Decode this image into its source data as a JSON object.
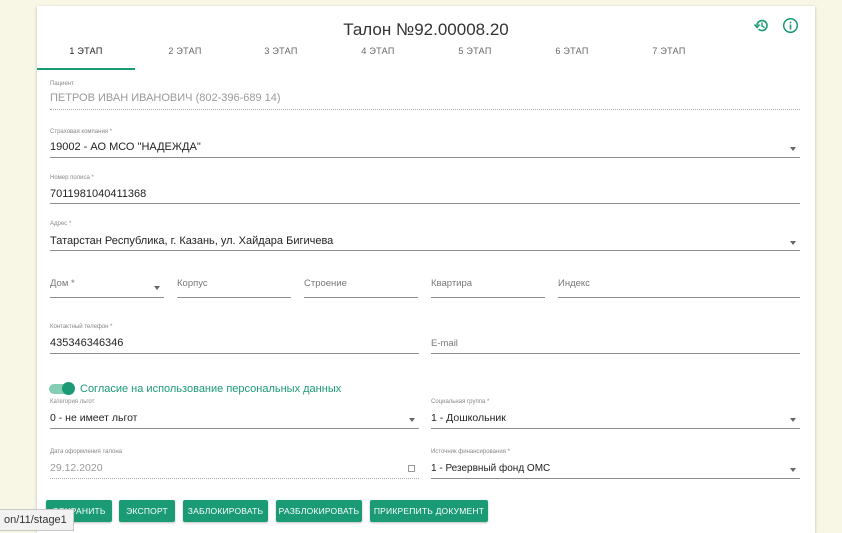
{
  "header": {
    "title": "Талон №92.00008.20",
    "history_icon": "history-icon",
    "info_icon": "info-icon",
    "accent_color": "#1a9b75"
  },
  "tabs": [
    {
      "label": "1 ЭТАП",
      "active": true
    },
    {
      "label": "2 ЭТАП",
      "active": false
    },
    {
      "label": "3 ЭТАП",
      "active": false
    },
    {
      "label": "4 ЭТАП",
      "active": false
    },
    {
      "label": "5 ЭТАП",
      "active": false
    },
    {
      "label": "6 ЭТАП",
      "active": false
    },
    {
      "label": "7 ЭТАП",
      "active": false
    }
  ],
  "form": {
    "patient": {
      "label": "Пациент",
      "value": "ПЕТРОВ ИВАН ИВАНОВИЧ (802-396-689 14)"
    },
    "insurance": {
      "label": "Страховая компания *",
      "value": "19002 - АО МСО \"НАДЕЖДА\""
    },
    "policy": {
      "label": "Номер полиса *",
      "value": "7011981040411368"
    },
    "address": {
      "label": "Адрес *",
      "value": "Татарстан Республика, г. Казань, ул. Хайдара Бигичева"
    },
    "house": {
      "placeholder": "Дом *"
    },
    "building": {
      "placeholder": "Корпус"
    },
    "structure": {
      "placeholder": "Строение"
    },
    "apartment": {
      "placeholder": "Квартира"
    },
    "index": {
      "placeholder": "Индекс"
    },
    "phone": {
      "label": "Контактный телефон *",
      "value": "435346346346"
    },
    "email": {
      "placeholder": "E-mail"
    },
    "consent": {
      "label": "Согласие на использование персональных данных",
      "checked": true
    },
    "benefit": {
      "label": "Категория льгот",
      "value": "0 - не имеет льгот"
    },
    "social_group": {
      "label": "Социальная группа *",
      "value": "1 - Дошкольник"
    },
    "issue_date": {
      "label": "Дата оформления талона",
      "value": "29.12.2020"
    },
    "funding": {
      "label": "Источник финансирования *",
      "value": "1 - Резервный фонд ОМС"
    }
  },
  "buttons": {
    "save": "СОХРАНИТЬ",
    "export": "ЭКСПОРТ",
    "lock": "ЗАБЛОКИРОВАТЬ",
    "unlock": "РАЗБЛОКИРОВАТЬ",
    "attach": "ПРИКРЕПИТЬ ДОКУМЕНТ"
  },
  "statusbar": {
    "url_fragment": "on/11/stage1"
  }
}
